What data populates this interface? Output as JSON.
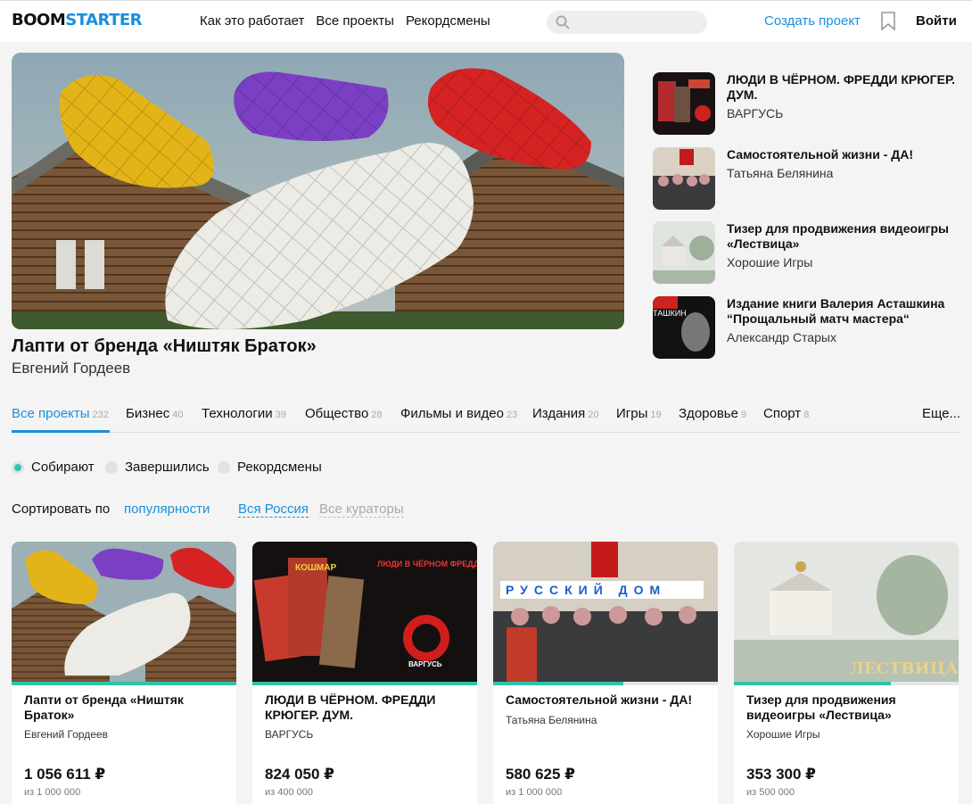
{
  "header": {
    "logo_part1": "BOOM",
    "logo_part2": "STARTER",
    "nav": [
      "Как это работает",
      "Все проекты",
      "Рекордсмены"
    ],
    "create": "Создать проект",
    "login": "Войти"
  },
  "hero": {
    "title": "Лапти от бренда «Ништяк Браток»",
    "author": "Евгений Гордеев"
  },
  "side": [
    {
      "title": "ЛЮДИ В ЧЁРНОМ. ФРЕДДИ КРЮГЕР. ДУМ.",
      "author": "ВАРГУСЬ"
    },
    {
      "title": "Самостоятельной жизни - ДА!",
      "author": "Татьяна Белянина"
    },
    {
      "title": "Тизер для продвижения видеоигры «Лествица»",
      "author": "Хорошие Игры"
    },
    {
      "title": "Издание книги Валерия Асташкина “Прощальный матч мастера“",
      "author": "Александр Старых"
    }
  ],
  "categories": [
    {
      "label": "Все проекты",
      "count": "232"
    },
    {
      "label": "Бизнес",
      "count": "40"
    },
    {
      "label": "Технологии",
      "count": "39"
    },
    {
      "label": "Общество",
      "count": "28"
    },
    {
      "label": "Фильмы и видео",
      "count": "23"
    },
    {
      "label": "Издания",
      "count": "20"
    },
    {
      "label": "Игры",
      "count": "19"
    },
    {
      "label": "Здоровье",
      "count": "9"
    },
    {
      "label": "Спорт",
      "count": "8"
    }
  ],
  "more": "Еще...",
  "statuses": [
    "Собирают",
    "Завершились",
    "Рекордсмены"
  ],
  "sort": {
    "label": "Сортировать по",
    "by": "популярности",
    "region": "Вся Россия",
    "curators": "Все кураторы"
  },
  "cards": [
    {
      "title": "Лапти от бренда «Ништяк Браток»",
      "author": "Евгений Гордеев",
      "sum": "1 056 611 ₽",
      "goal": "из 1 000 000",
      "progress": 1.0
    },
    {
      "title": "ЛЮДИ В ЧЁРНОМ. ФРЕДДИ КРЮГЕР. ДУМ.",
      "author": "ВАРГУСЬ",
      "sum": "824 050 ₽",
      "goal": "из 400 000",
      "progress": 1.0
    },
    {
      "title": "Самостоятельной жизни - ДА!",
      "author": "Татьяна Белянина",
      "sum": "580 625 ₽",
      "goal": "из 1 000 000",
      "progress": 0.58
    },
    {
      "title": "Тизер для продвижения видеоигры «Лествица»",
      "author": "Хорошие Игры",
      "sum": "353 300 ₽",
      "goal": "из 500 000",
      "progress": 0.7
    }
  ],
  "image_text": {
    "comic1": "КОШМАР",
    "poster": "ЛЮДИ В ЧЁРНОМ ФРЕДДИ КРЮГЕР ДУМ",
    "badge": "ВАРГУСЬ",
    "banner": "РУССКИЙ ДОМ",
    "game": "ЛЕСТВИЦА",
    "book": "ТАШКИН"
  },
  "colors": {
    "accent": "#1a8fdc",
    "progress": "#2ec4a9"
  }
}
